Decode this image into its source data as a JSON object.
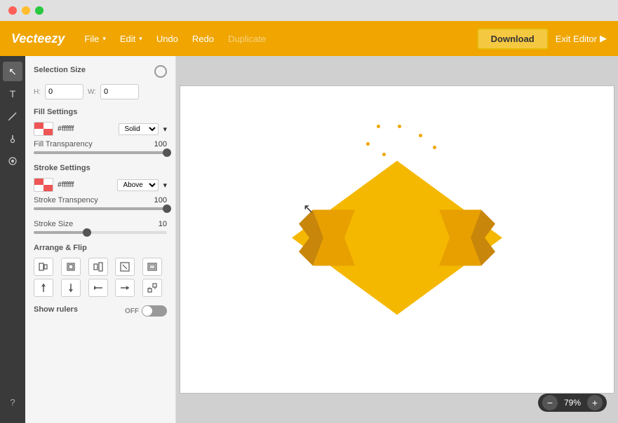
{
  "titlebar": {
    "buttons": [
      "close",
      "minimize",
      "maximize"
    ]
  },
  "topnav": {
    "logo": "Vecteezy",
    "menu": [
      {
        "label": "File",
        "hasDropdown": true
      },
      {
        "label": "Edit",
        "hasDropdown": true
      },
      {
        "label": "Undo",
        "hasDropdown": false,
        "disabled": false
      },
      {
        "label": "Redo",
        "hasDropdown": false,
        "disabled": false
      },
      {
        "label": "Duplicate",
        "hasDropdown": false,
        "disabled": true
      }
    ],
    "download_label": "Download",
    "exit_label": "Exit Editor"
  },
  "left_panel": {
    "selection_size_title": "Selection Size",
    "h_label": "H:",
    "w_label": "W:",
    "h_value": "0",
    "w_value": "0",
    "fill_settings_title": "Fill Settings",
    "fill_color": "#ffffff",
    "fill_type": "Solid",
    "fill_transparency_label": "Fill Transparency",
    "fill_transparency_value": "100",
    "stroke_settings_title": "Stroke Settings",
    "stroke_color": "#ffffff",
    "stroke_position": "Above",
    "stroke_transparency_label": "Stroke Transpency",
    "stroke_transparency_value": "100",
    "stroke_size_label": "Stroke Size",
    "stroke_size_value": "10",
    "arrange_flip_title": "Arrange & Flip",
    "arrange_buttons": [
      "□",
      "⊡",
      "⊟",
      "⊠",
      "▣",
      "↕",
      "↓",
      "↔",
      "↻",
      "📊"
    ],
    "show_rulers_label": "Show rulers",
    "toggle_state": "OFF"
  },
  "toolbar_tools": [
    {
      "name": "select",
      "icon": "↖"
    },
    {
      "name": "text",
      "icon": "T"
    },
    {
      "name": "pen",
      "icon": "✏"
    },
    {
      "name": "brush",
      "icon": "🖌"
    },
    {
      "name": "shapes",
      "icon": "◉"
    }
  ],
  "canvas": {
    "zoom_minus": "−",
    "zoom_value": "79%",
    "zoom_plus": "+"
  }
}
